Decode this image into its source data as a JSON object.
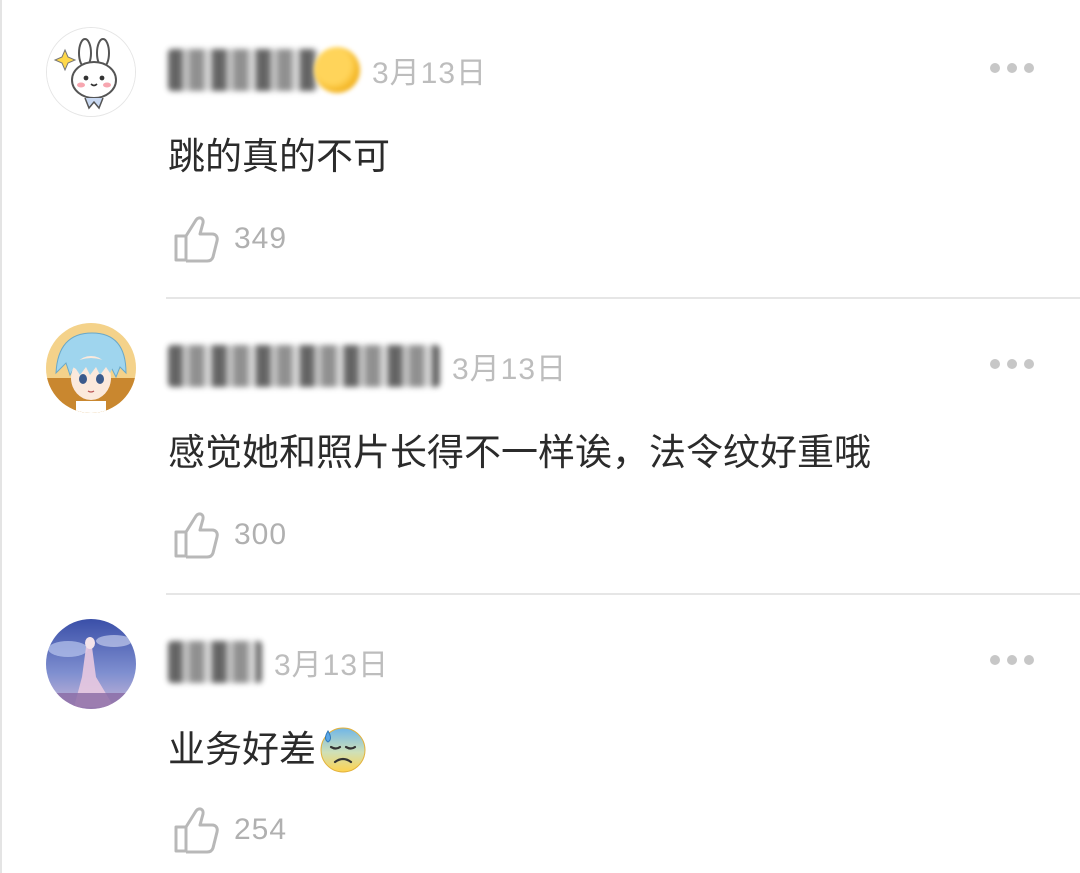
{
  "comments": [
    {
      "author": "",
      "date": "3月13日",
      "text": "跳的真的不可",
      "likes": "349",
      "avatar": "bunny-avatar"
    },
    {
      "author": "",
      "date": "3月13日",
      "text": "感觉她和照片长得不一样诶，法令纹好重哦",
      "likes": "300",
      "avatar": "anime-boy-avatar"
    },
    {
      "author": "",
      "date": "3月13日",
      "text": "业务好差",
      "emoji": "cold-sweat-emoji",
      "likes": "254",
      "avatar": "scenery-avatar"
    }
  ],
  "colors": {
    "date": "#bdbdbd",
    "text": "#2b2b2b",
    "likes": "#b0b0b0",
    "divider": "#e6e6e6"
  },
  "icons": {
    "like": "thumbs-up-icon",
    "more": "more-dots-icon"
  }
}
